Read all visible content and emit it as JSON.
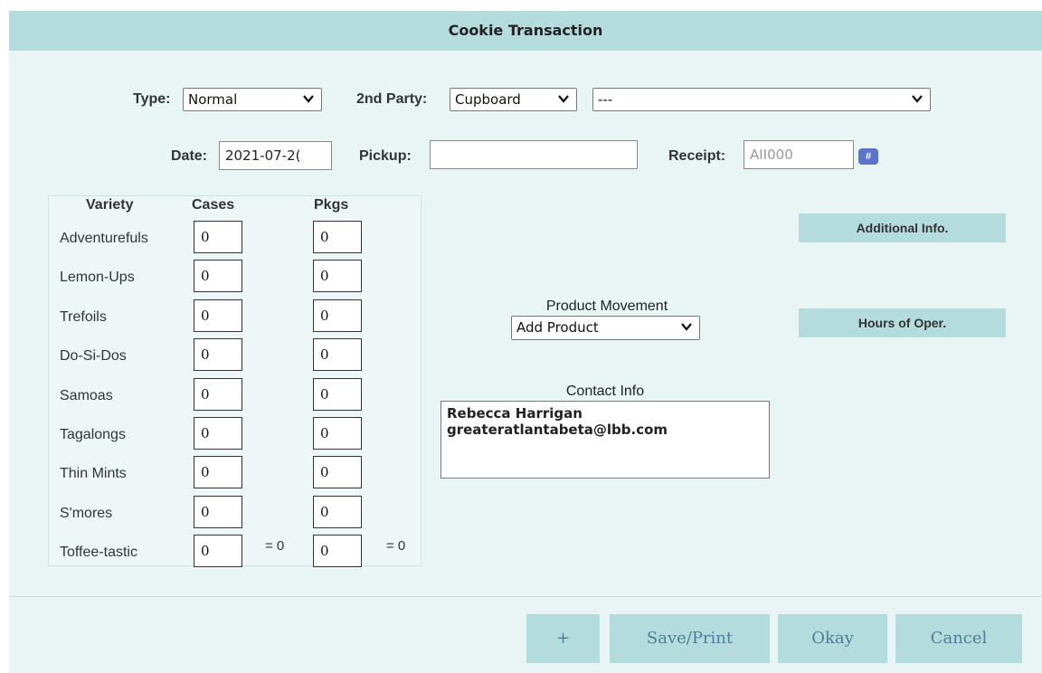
{
  "dialog": {
    "title": "Cookie Transaction"
  },
  "form": {
    "type_label": "Type:",
    "type_value": "Normal",
    "second_party_label": "2nd Party:",
    "second_party_value": "Cupboard",
    "party_detail_value": "---",
    "date_label": "Date:",
    "date_value": "2021-07-2(",
    "pickup_label": "Pickup:",
    "pickup_value": "",
    "receipt_label": "Receipt:",
    "receipt_placeholder": "AII000",
    "receipt_button_label": "#"
  },
  "varieties": {
    "headers": {
      "variety": "Variety",
      "cases": "Cases",
      "pkgs": "Pkgs"
    },
    "rows": [
      {
        "name": "Adventurefuls",
        "cases": "0",
        "pkgs": "0"
      },
      {
        "name": "Lemon-Ups",
        "cases": "0",
        "pkgs": "0"
      },
      {
        "name": "Trefoils",
        "cases": "0",
        "pkgs": "0"
      },
      {
        "name": "Do-Si-Dos",
        "cases": "0",
        "pkgs": "0"
      },
      {
        "name": "Samoas",
        "cases": "0",
        "pkgs": "0"
      },
      {
        "name": "Tagalongs",
        "cases": "0",
        "pkgs": "0"
      },
      {
        "name": "Thin Mints",
        "cases": "0",
        "pkgs": "0"
      },
      {
        "name": "S'mores",
        "cases": "0",
        "pkgs": "0"
      },
      {
        "name": "Toffee-tastic",
        "cases": "0",
        "pkgs": "0"
      }
    ],
    "cases_total": "= 0",
    "pkgs_total": "= 0"
  },
  "product_movement": {
    "label": "Product Movement",
    "value": "Add Product"
  },
  "contact": {
    "label": "Contact Info",
    "name": "Rebecca Harrigan",
    "email": "greateratlantabeta@lbb.com"
  },
  "side_buttons": {
    "additional_info": "Additional Info.",
    "hours": "Hours of Oper."
  },
  "footer": {
    "plus": "+",
    "save_print": "Save/Print",
    "okay": "Okay",
    "cancel": "Cancel"
  },
  "colors": {
    "accent": "#b4dcdc",
    "dialog_bg": "#e9f4f5",
    "footer_text": "#4d7d99",
    "hash_button": "#5c74c8"
  }
}
